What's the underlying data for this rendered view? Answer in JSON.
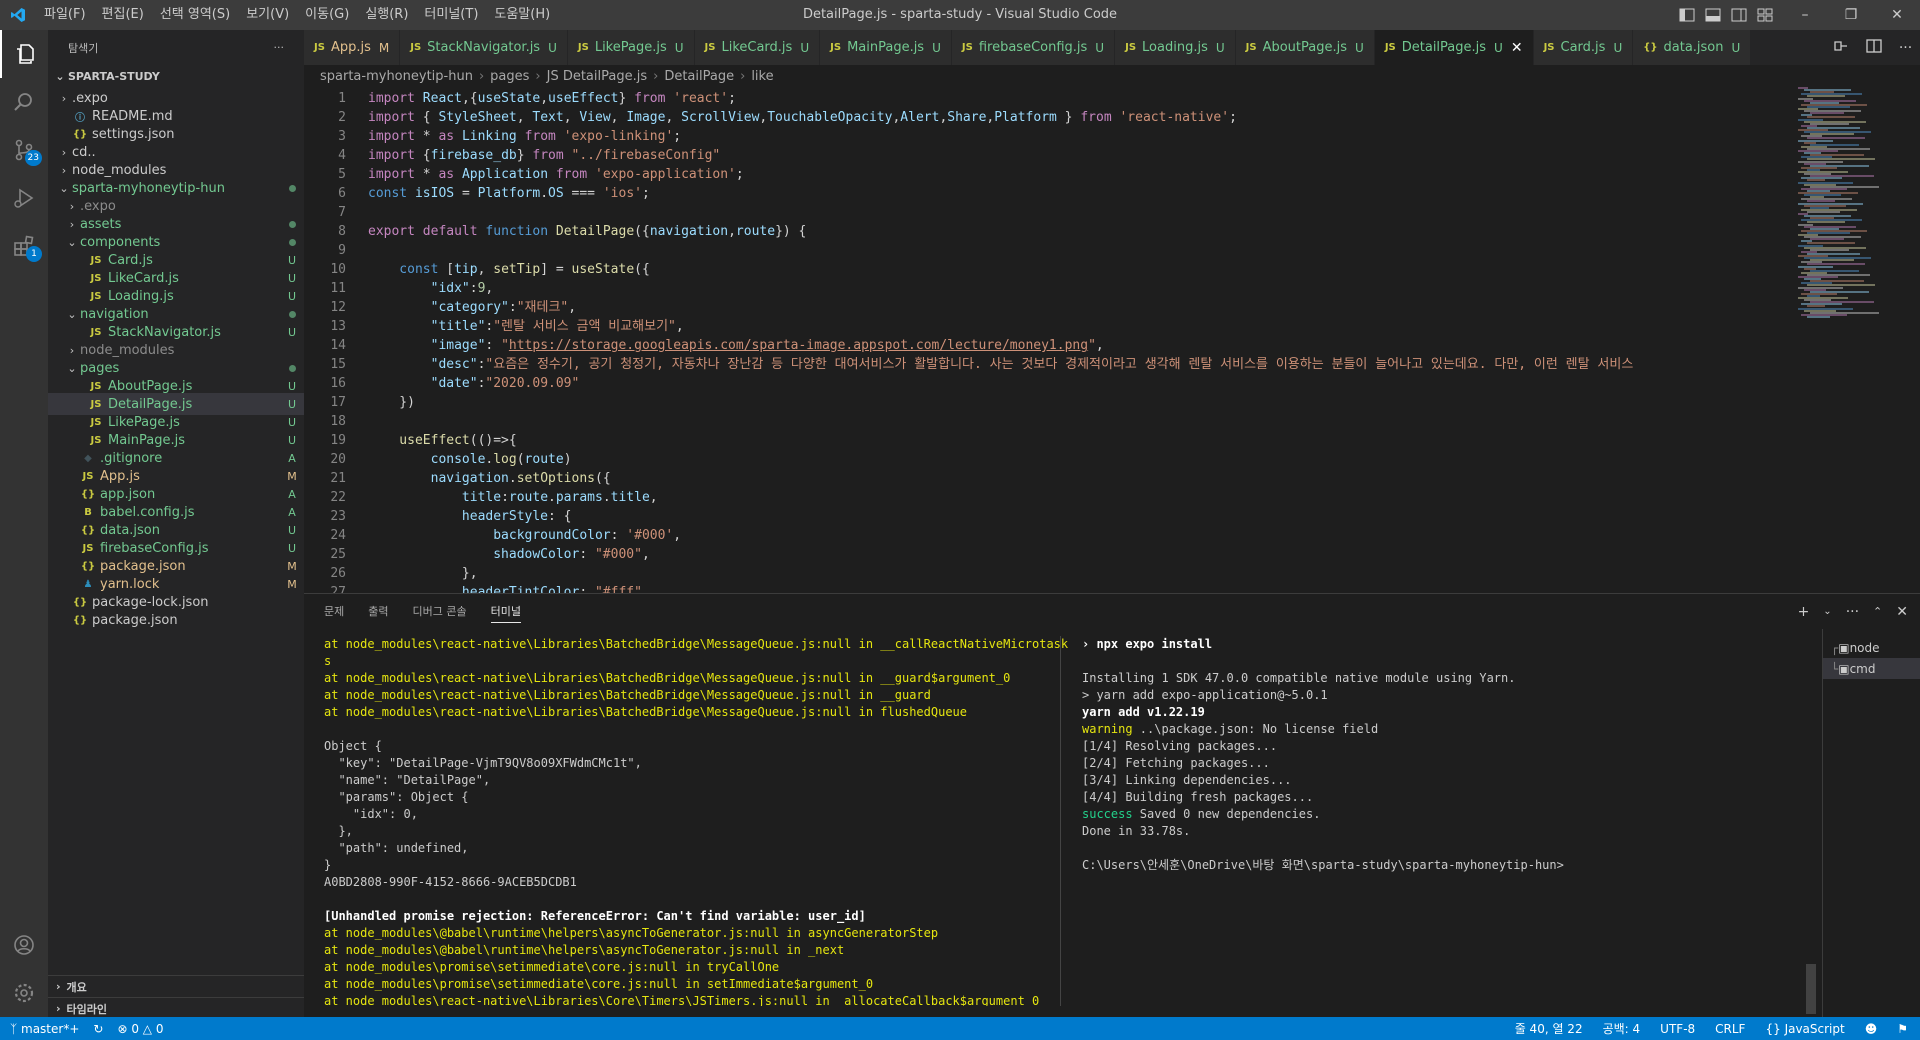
{
  "window": {
    "title": "DetailPage.js - sparta-study - Visual Studio Code"
  },
  "menu": [
    "파일(F)",
    "편집(E)",
    "선택 영역(S)",
    "보기(V)",
    "이동(G)",
    "실행(R)",
    "터미널(T)",
    "도움말(H)"
  ],
  "activity": {
    "scm_badge": "23",
    "ext_badge": "1"
  },
  "explorer": {
    "title": "탐색기",
    "section": "SPARTA-STUDY",
    "more": "···",
    "rows": [
      {
        "name": ".expo",
        "kind": "folder",
        "depth": 0,
        "open": false,
        "status": "",
        "color": "#cccccc"
      },
      {
        "name": "README.md",
        "kind": "md",
        "depth": 0,
        "status": "",
        "color": "#cccccc",
        "icon": "ⓘ",
        "iconColor": "#519aba"
      },
      {
        "name": "settings.json",
        "kind": "json",
        "depth": 0,
        "status": "",
        "color": "#cccccc",
        "icon": "{}",
        "iconColor": "#cbcb41"
      },
      {
        "name": "cd..",
        "kind": "folder",
        "depth": 0,
        "open": false,
        "status": "",
        "color": "#cccccc"
      },
      {
        "name": "node_modules",
        "kind": "folder",
        "depth": 0,
        "open": false,
        "status": "",
        "color": "#cccccc"
      },
      {
        "name": "sparta-myhoneytip-hun",
        "kind": "folder",
        "depth": 0,
        "open": true,
        "status": "dot",
        "color": "#73c991"
      },
      {
        "name": ".expo",
        "kind": "folder",
        "depth": 1,
        "open": false,
        "status": "",
        "color": "#8c8c8c"
      },
      {
        "name": "assets",
        "kind": "folder",
        "depth": 1,
        "open": false,
        "status": "dot",
        "color": "#73c991"
      },
      {
        "name": "components",
        "kind": "folder",
        "depth": 1,
        "open": true,
        "status": "dot",
        "color": "#73c991"
      },
      {
        "name": "Card.js",
        "kind": "js",
        "depth": 2,
        "status": "U",
        "color": "#73c991",
        "icon": "JS",
        "iconColor": "#cbcb41"
      },
      {
        "name": "LikeCard.js",
        "kind": "js",
        "depth": 2,
        "status": "U",
        "color": "#73c991",
        "icon": "JS",
        "iconColor": "#cbcb41"
      },
      {
        "name": "Loading.js",
        "kind": "js",
        "depth": 2,
        "status": "U",
        "color": "#73c991",
        "icon": "JS",
        "iconColor": "#cbcb41"
      },
      {
        "name": "navigation",
        "kind": "folder",
        "depth": 1,
        "open": true,
        "status": "dot",
        "color": "#73c991"
      },
      {
        "name": "StackNavigator.js",
        "kind": "js",
        "depth": 2,
        "status": "U",
        "color": "#73c991",
        "icon": "JS",
        "iconColor": "#cbcb41"
      },
      {
        "name": "node_modules",
        "kind": "folder",
        "depth": 1,
        "open": false,
        "status": "",
        "color": "#8c8c8c"
      },
      {
        "name": "pages",
        "kind": "folder",
        "depth": 1,
        "open": true,
        "status": "dot",
        "color": "#73c991"
      },
      {
        "name": "AboutPage.js",
        "kind": "js",
        "depth": 2,
        "status": "U",
        "color": "#73c991",
        "icon": "JS",
        "iconColor": "#cbcb41"
      },
      {
        "name": "DetailPage.js",
        "kind": "js",
        "depth": 2,
        "status": "U",
        "color": "#73c991",
        "icon": "JS",
        "iconColor": "#cbcb41",
        "selected": true
      },
      {
        "name": "LikePage.js",
        "kind": "js",
        "depth": 2,
        "status": "U",
        "color": "#73c991",
        "icon": "JS",
        "iconColor": "#cbcb41"
      },
      {
        "name": "MainPage.js",
        "kind": "js",
        "depth": 2,
        "status": "U",
        "color": "#73c991",
        "icon": "JS",
        "iconColor": "#cbcb41"
      },
      {
        "name": ".gitignore",
        "kind": "git",
        "depth": 1,
        "status": "A",
        "color": "#73c991",
        "icon": "◆",
        "iconColor": "#41535b"
      },
      {
        "name": "App.js",
        "kind": "js",
        "depth": 1,
        "status": "M",
        "color": "#e2c08d",
        "icon": "JS",
        "iconColor": "#cbcb41"
      },
      {
        "name": "app.json",
        "kind": "json",
        "depth": 1,
        "status": "A",
        "color": "#73c991",
        "icon": "{}",
        "iconColor": "#cbcb41"
      },
      {
        "name": "babel.config.js",
        "kind": "babel",
        "depth": 1,
        "status": "A",
        "color": "#73c991",
        "icon": "B",
        "iconColor": "#cbcb41"
      },
      {
        "name": "data.json",
        "kind": "json",
        "depth": 1,
        "status": "U",
        "color": "#73c991",
        "icon": "{}",
        "iconColor": "#cbcb41"
      },
      {
        "name": "firebaseConfig.js",
        "kind": "js",
        "depth": 1,
        "status": "U",
        "color": "#73c991",
        "icon": "JS",
        "iconColor": "#cbcb41"
      },
      {
        "name": "package.json",
        "kind": "json",
        "depth": 1,
        "status": "M",
        "color": "#e2c08d",
        "icon": "{}",
        "iconColor": "#cbcb41"
      },
      {
        "name": "yarn.lock",
        "kind": "yarn",
        "depth": 1,
        "status": "M",
        "color": "#e2c08d",
        "icon": "♟",
        "iconColor": "#2c8ebb"
      },
      {
        "name": "package-lock.json",
        "kind": "json",
        "depth": 0,
        "status": "",
        "color": "#cccccc",
        "icon": "{}",
        "iconColor": "#cbcb41"
      },
      {
        "name": "package.json",
        "kind": "json",
        "depth": 0,
        "status": "",
        "color": "#cccccc",
        "icon": "{}",
        "iconColor": "#cbcb41"
      }
    ],
    "outline": "개요",
    "timeline": "타임라인"
  },
  "tabs": [
    {
      "icon": "JS",
      "label": "App.js",
      "status": "M",
      "color": "#e2c08d"
    },
    {
      "icon": "JS",
      "label": "StackNavigator.js",
      "status": "U",
      "color": "#73c991"
    },
    {
      "icon": "JS",
      "label": "LikePage.js",
      "status": "U",
      "color": "#73c991"
    },
    {
      "icon": "JS",
      "label": "LikeCard.js",
      "status": "U",
      "color": "#73c991"
    },
    {
      "icon": "JS",
      "label": "MainPage.js",
      "status": "U",
      "color": "#73c991"
    },
    {
      "icon": "JS",
      "label": "firebaseConfig.js",
      "status": "U",
      "color": "#73c991"
    },
    {
      "icon": "JS",
      "label": "Loading.js",
      "status": "U",
      "color": "#73c991"
    },
    {
      "icon": "JS",
      "label": "AboutPage.js",
      "status": "U",
      "color": "#73c991"
    },
    {
      "icon": "JS",
      "label": "DetailPage.js",
      "status": "U",
      "color": "#73c991",
      "active": true
    },
    {
      "icon": "JS",
      "label": "Card.js",
      "status": "U",
      "color": "#73c991"
    },
    {
      "icon": "{}",
      "label": "data.json",
      "status": "U",
      "color": "#73c991"
    }
  ],
  "breadcrumb": [
    "sparta-myhoneytip-hun",
    "pages",
    "JS DetailPage.js",
    "DetailPage",
    "like"
  ],
  "editor": {
    "lines": [
      [
        [
          "import ",
          "c"
        ],
        [
          "React",
          "v"
        ],
        [
          ",{",
          "w"
        ],
        [
          "useState",
          "v"
        ],
        [
          ",",
          "w"
        ],
        [
          "useEffect",
          "v"
        ],
        [
          "} ",
          "w"
        ],
        [
          "from ",
          "c"
        ],
        [
          "'react'",
          "s"
        ],
        [
          ";",
          "w"
        ]
      ],
      [
        [
          "import ",
          "c"
        ],
        [
          "{ ",
          "w"
        ],
        [
          "StyleSheet",
          "v"
        ],
        [
          ", ",
          "w"
        ],
        [
          "Text",
          "v"
        ],
        [
          ", ",
          "w"
        ],
        [
          "View",
          "v"
        ],
        [
          ", ",
          "w"
        ],
        [
          "Image",
          "v"
        ],
        [
          ", ",
          "w"
        ],
        [
          "ScrollView",
          "v"
        ],
        [
          ",",
          "w"
        ],
        [
          "TouchableOpacity",
          "v"
        ],
        [
          ",",
          "w"
        ],
        [
          "Alert",
          "v"
        ],
        [
          ",",
          "w"
        ],
        [
          "Share",
          "v"
        ],
        [
          ",",
          "w"
        ],
        [
          "Platform",
          "v"
        ],
        [
          " } ",
          "w"
        ],
        [
          "from ",
          "c"
        ],
        [
          "'react-native'",
          "s"
        ],
        [
          ";",
          "w"
        ]
      ],
      [
        [
          "import ",
          "c"
        ],
        [
          "* ",
          "w"
        ],
        [
          "as ",
          "c"
        ],
        [
          "Linking ",
          "v"
        ],
        [
          "from ",
          "c"
        ],
        [
          "'expo-linking'",
          "s"
        ],
        [
          ";",
          "w"
        ]
      ],
      [
        [
          "import ",
          "c"
        ],
        [
          "{",
          "w"
        ],
        [
          "firebase_db",
          "v"
        ],
        [
          "} ",
          "w"
        ],
        [
          "from ",
          "c"
        ],
        [
          "\"../firebaseConfig\"",
          "s"
        ]
      ],
      [
        [
          "import ",
          "c"
        ],
        [
          "* ",
          "w"
        ],
        [
          "as ",
          "c"
        ],
        [
          "Application ",
          "v"
        ],
        [
          "from ",
          "c"
        ],
        [
          "'expo-application'",
          "s"
        ],
        [
          ";",
          "w"
        ]
      ],
      [
        [
          "const ",
          "k"
        ],
        [
          "isIOS ",
          "v"
        ],
        [
          "= ",
          "w"
        ],
        [
          "Platform",
          "v"
        ],
        [
          ".",
          "w"
        ],
        [
          "OS ",
          "v"
        ],
        [
          "=== ",
          "w"
        ],
        [
          "'ios'",
          "s"
        ],
        [
          ";",
          "w"
        ]
      ],
      [],
      [
        [
          "export ",
          "c"
        ],
        [
          "default ",
          "c"
        ],
        [
          "function ",
          "k"
        ],
        [
          "DetailPage",
          "f"
        ],
        [
          "({",
          "w"
        ],
        [
          "navigation",
          "v"
        ],
        [
          ",",
          "w"
        ],
        [
          "route",
          "v"
        ],
        [
          "}) {",
          "w"
        ]
      ],
      [],
      [
        [
          "    const ",
          "k"
        ],
        [
          "[",
          "w"
        ],
        [
          "tip",
          "v"
        ],
        [
          ", ",
          "w"
        ],
        [
          "setTip",
          "f"
        ],
        [
          "] = ",
          "w"
        ],
        [
          "useState",
          "f"
        ],
        [
          "({",
          "w"
        ]
      ],
      [
        [
          "        \"idx\"",
          "v"
        ],
        [
          ":",
          "w"
        ],
        [
          "9",
          "n"
        ],
        [
          ",",
          "w"
        ]
      ],
      [
        [
          "        \"category\"",
          "v"
        ],
        [
          ":",
          "w"
        ],
        [
          "\"재테크\"",
          "s"
        ],
        [
          ",",
          "w"
        ]
      ],
      [
        [
          "        \"title\"",
          "v"
        ],
        [
          ":",
          "w"
        ],
        [
          "\"렌탈 서비스 금액 비교해보기\"",
          "s"
        ],
        [
          ",",
          "w"
        ]
      ],
      [
        [
          "        \"image\"",
          "v"
        ],
        [
          ": ",
          "w"
        ],
        [
          "\"",
          "s"
        ],
        [
          "https://storage.googleapis.com/sparta-image.appspot.com/lecture/money1.png",
          "u"
        ],
        [
          "\"",
          "s"
        ],
        [
          ",",
          "w"
        ]
      ],
      [
        [
          "        \"desc\"",
          "v"
        ],
        [
          ":",
          "w"
        ],
        [
          "\"요즘은 정수기, 공기 청정기, 자동차나 장난감 등 다양한 대여서비스가 활발합니다. 사는 것보다 경제적이라고 생각해 렌탈 서비스를 이용하는 분들이 늘어나고 있는데요. 다만, 이런 렌탈 서비스",
          "s"
        ]
      ],
      [
        [
          "        \"date\"",
          "v"
        ],
        [
          ":",
          "w"
        ],
        [
          "\"2020.09.09\"",
          "s"
        ]
      ],
      [
        [
          "    })",
          "w"
        ]
      ],
      [],
      [
        [
          "    useEffect",
          "f"
        ],
        [
          "(()=>{",
          "w"
        ]
      ],
      [
        [
          "        console",
          "v"
        ],
        [
          ".",
          "w"
        ],
        [
          "log",
          "f"
        ],
        [
          "(",
          "w"
        ],
        [
          "route",
          "v"
        ],
        [
          ")",
          "w"
        ]
      ],
      [
        [
          "        navigation",
          "v"
        ],
        [
          ".",
          "w"
        ],
        [
          "setOptions",
          "f"
        ],
        [
          "({",
          "w"
        ]
      ],
      [
        [
          "            title",
          "v"
        ],
        [
          ":",
          "w"
        ],
        [
          "route",
          "v"
        ],
        [
          ".",
          "w"
        ],
        [
          "params",
          "v"
        ],
        [
          ".",
          "w"
        ],
        [
          "title",
          "v"
        ],
        [
          ",",
          "w"
        ]
      ],
      [
        [
          "            headerStyle",
          "v"
        ],
        [
          ": {",
          "w"
        ]
      ],
      [
        [
          "                backgroundColor",
          "v"
        ],
        [
          ": ",
          "w"
        ],
        [
          "'#000'",
          "s"
        ],
        [
          ",",
          "w"
        ]
      ],
      [
        [
          "                shadowColor",
          "v"
        ],
        [
          ": ",
          "w"
        ],
        [
          "\"#000\"",
          "s"
        ],
        [
          ",",
          "w"
        ]
      ],
      [
        [
          "            },",
          "w"
        ]
      ],
      [
        [
          "            headerTintColor",
          "v"
        ],
        [
          ": ",
          "w"
        ],
        [
          "\"#fff\"",
          "s"
        ],
        [
          ",",
          "w"
        ]
      ]
    ]
  },
  "panel": {
    "tabs": [
      "문제",
      "출력",
      "디버그 콘솔",
      "터미널"
    ],
    "active_tab": "터미널",
    "left": [
      [
        [
          "at node_modules\\react-native\\Libraries\\BatchedBridge\\MessageQueue.js:null in __callReactNativeMicrotask",
          "ty"
        ]
      ],
      [
        [
          "s",
          "ty"
        ]
      ],
      [
        [
          "at node_modules\\react-native\\Libraries\\BatchedBridge\\MessageQueue.js:null in __guard$argument_0",
          "ty"
        ]
      ],
      [
        [
          "at node_modules\\react-native\\Libraries\\BatchedBridge\\MessageQueue.js:null in __guard",
          "ty"
        ]
      ],
      [
        [
          "at node_modules\\react-native\\Libraries\\BatchedBridge\\MessageQueue.js:null in flushedQueue",
          "ty"
        ]
      ],
      [],
      [
        [
          "Object {",
          ""
        ]
      ],
      [
        [
          "  \"key\": \"DetailPage-VjmT9QV8o09XFWdmCMc1t\",",
          ""
        ]
      ],
      [
        [
          "  \"name\": \"DetailPage\",",
          ""
        ]
      ],
      [
        [
          "  \"params\": Object {",
          ""
        ]
      ],
      [
        [
          "    \"idx\": 0,",
          ""
        ]
      ],
      [
        [
          "  },",
          ""
        ]
      ],
      [
        [
          "  \"path\": undefined,",
          ""
        ]
      ],
      [
        [
          "}",
          ""
        ]
      ],
      [
        [
          "A0BD2808-990F-4152-8666-9ACEB5DCDB1",
          ""
        ]
      ],
      [],
      [
        [
          "[Unhandled promise rejection: ReferenceError: Can't find variable: user_id]",
          "ty tb"
        ]
      ],
      [
        [
          "at node_modules\\@babel\\runtime\\helpers\\asyncToGenerator.js:null in asyncGeneratorStep",
          "ty"
        ]
      ],
      [
        [
          "at node_modules\\@babel\\runtime\\helpers\\asyncToGenerator.js:null in _next",
          "ty"
        ]
      ],
      [
        [
          "at node_modules\\promise\\setimmediate\\core.js:null in tryCallOne",
          "ty"
        ]
      ],
      [
        [
          "at node_modules\\promise\\setimmediate\\core.js:null in setImmediate$argument_0",
          "ty"
        ]
      ],
      [
        [
          "at node_modules\\react-native\\Libraries\\Core\\Timers\\JSTimers.js:null in _allocateCallback$argument_0",
          "ty"
        ]
      ]
    ],
    "right": [
      [
        [
          "› npx expo install",
          "tb"
        ]
      ],
      [],
      [
        [
          "Installing 1 SDK 47.0.0 compatible native module using Yarn.",
          ""
        ]
      ],
      [
        [
          "> yarn add expo-application@~5.0.1",
          ""
        ]
      ],
      [
        [
          "yarn add v1.22.19",
          "tb"
        ]
      ],
      [
        [
          "warning ",
          "ty"
        ],
        [
          "..\\package.json: No license field",
          ""
        ]
      ],
      [
        [
          "[1/4] Resolving packages...",
          ""
        ]
      ],
      [
        [
          "[2/4] Fetching packages...",
          ""
        ]
      ],
      [
        [
          "[3/4] Linking dependencies...",
          ""
        ]
      ],
      [
        [
          "[4/4] Building fresh packages...",
          ""
        ]
      ],
      [
        [
          "success ",
          "tg"
        ],
        [
          "Saved 0 new dependencies.",
          ""
        ]
      ],
      [
        [
          "Done in 33.78s.",
          ""
        ]
      ],
      [],
      [
        [
          "C:\\Users\\안세훈\\OneDrive\\바탕 화면\\sparta-study\\sparta-myhoneytip-hun>",
          ""
        ]
      ]
    ],
    "terminals": [
      "node",
      "cmd"
    ]
  },
  "status": {
    "branch": "master*+",
    "errors": "0",
    "warnings": "0",
    "position": "줄 40, 열 22",
    "spaces": "공백: 4",
    "encoding": "UTF-8",
    "eol": "CRLF",
    "language": "JavaScript"
  }
}
